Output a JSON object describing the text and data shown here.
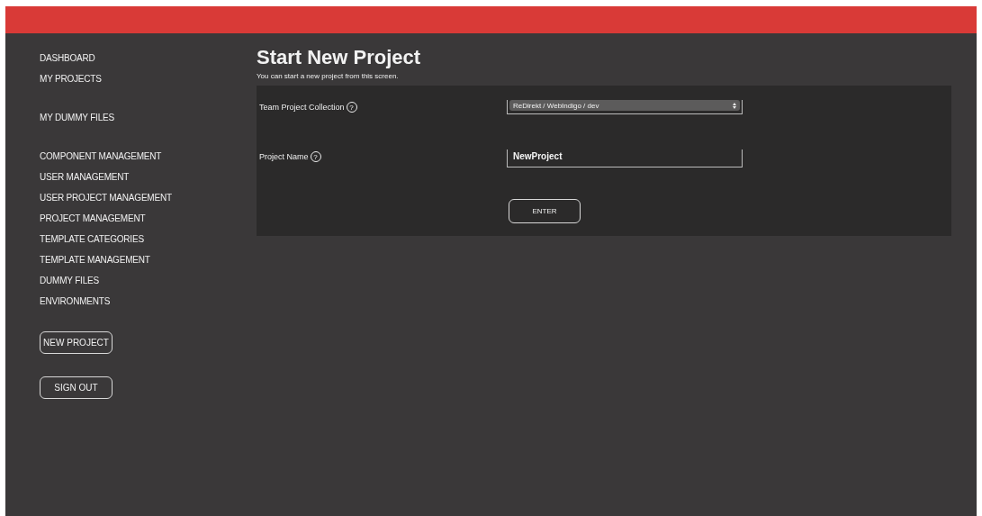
{
  "sidebar": {
    "groups": [
      {
        "items": [
          "DASHBOARD",
          "MY PROJECTS"
        ]
      },
      {
        "items": [
          "MY DUMMY FILES"
        ]
      },
      {
        "items": [
          "COMPONENT MANAGEMENT",
          "USER MANAGEMENT",
          "USER PROJECT MANAGEMENT",
          "PROJECT MANAGEMENT",
          "TEMPLATE CATEGORIES",
          "TEMPLATE MANAGEMENT",
          "DUMMY FILES",
          "ENVIRONMENTS"
        ]
      }
    ],
    "buttons": [
      "NEW PROJECT",
      "SIGN OUT"
    ]
  },
  "page": {
    "title": "Start New Project",
    "subtitle": "You can start a new project from this screen."
  },
  "form": {
    "fields": [
      {
        "kind": "select",
        "label": "Team Project Collection",
        "help": "?",
        "value": "ReDirekt / WebIndigo / dev"
      },
      {
        "kind": "text",
        "label": "Project Name",
        "help": "?",
        "value": "NewProject"
      }
    ],
    "submit": "ENTER"
  }
}
